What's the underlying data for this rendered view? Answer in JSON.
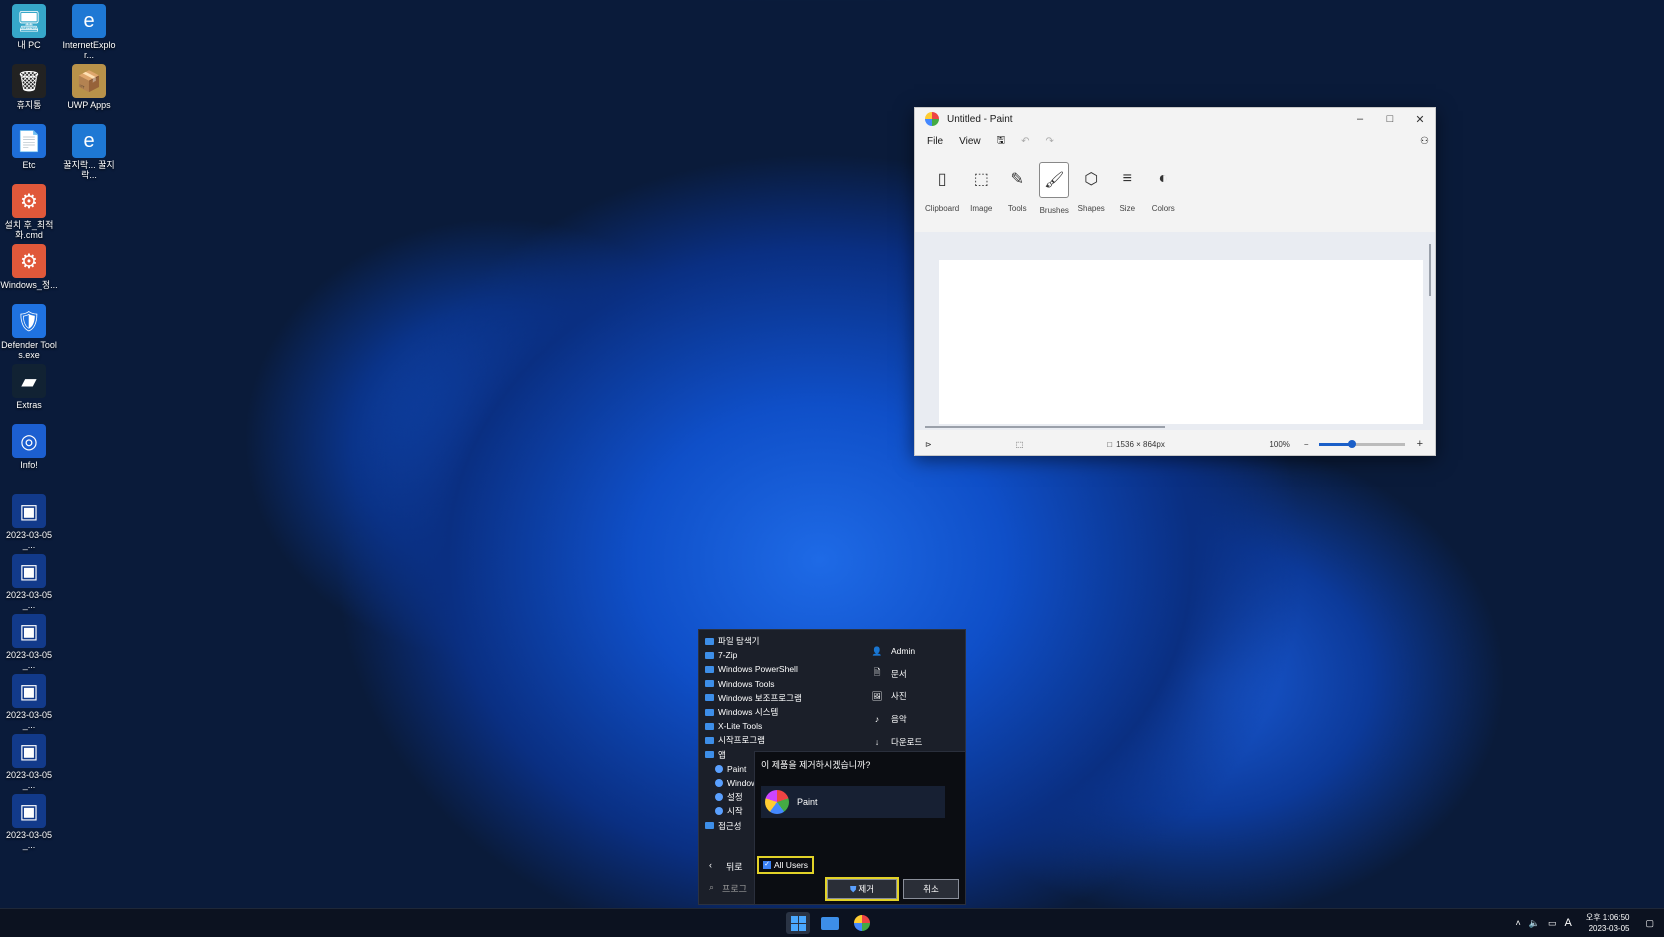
{
  "desktop": {
    "icons": [
      {
        "label": "내 PC",
        "glyph": "🖥"
      },
      {
        "label": "InternetExplor...",
        "glyph": "e"
      },
      {
        "label": "휴지통",
        "glyph": "🗑"
      },
      {
        "label": "UWP Apps",
        "glyph": "📦"
      },
      {
        "label": "Etc",
        "glyph": "📄"
      },
      {
        "label": "꿀지락... 꿀지락...",
        "glyph": "e"
      },
      {
        "label": "설치 후_최적화.cmd",
        "glyph": "⚙"
      },
      {
        "label": "Windows_정...",
        "glyph": "⚙"
      },
      {
        "label": "Defender Tools.exe",
        "glyph": "🛡"
      },
      {
        "label": "Extras",
        "glyph": "▰"
      },
      {
        "label": "Info!",
        "glyph": "◎"
      },
      {
        "label": "2023-03-05_...",
        "glyph": "▣"
      },
      {
        "label": "2023-03-05_...",
        "glyph": "▣"
      },
      {
        "label": "2023-03-05_...",
        "glyph": "▣"
      },
      {
        "label": "2023-03-05_...",
        "glyph": "▣"
      },
      {
        "label": "2023-03-05_...",
        "glyph": "▣"
      },
      {
        "label": "2023-03-05_...",
        "glyph": "▣"
      }
    ]
  },
  "paint": {
    "title": "Untitled - Paint",
    "menu": [
      "File",
      "View"
    ],
    "ribbon": [
      {
        "label": "Clipboard",
        "icon": "clipboard-icon",
        "glyph": "▯"
      },
      {
        "label": "Image",
        "icon": "select-icon",
        "glyph": "⬚"
      },
      {
        "label": "Tools",
        "icon": "tools-icon",
        "glyph": "✎"
      },
      {
        "label": "Brushes",
        "icon": "brush-icon",
        "glyph": "🖌"
      },
      {
        "label": "Shapes",
        "icon": "shapes-icon",
        "glyph": "⬡"
      },
      {
        "label": "Size",
        "icon": "size-icon",
        "glyph": "≡"
      },
      {
        "label": "Colors",
        "icon": "palette-icon",
        "glyph": "◐"
      }
    ],
    "status": {
      "dimensions": "1536 × 864px",
      "zoom": "100%"
    }
  },
  "start_menu": {
    "folders": [
      {
        "label": "파일 탐색기",
        "indent": false
      },
      {
        "label": "7-Zip",
        "indent": false
      },
      {
        "label": "Windows PowerShell",
        "indent": false
      },
      {
        "label": "Windows Tools",
        "indent": false
      },
      {
        "label": "Windows 보조프로그램",
        "indent": false
      },
      {
        "label": "Windows 시스템",
        "indent": false
      },
      {
        "label": "X-Lite Tools",
        "indent": false
      },
      {
        "label": "시작프로그램",
        "indent": false
      },
      {
        "label": "앱",
        "indent": false
      },
      {
        "label": "Paint",
        "indent": true
      },
      {
        "label": "Window",
        "indent": true
      },
      {
        "label": "설정",
        "indent": true
      },
      {
        "label": "시작",
        "indent": true
      },
      {
        "label": "접근성",
        "indent": false
      }
    ],
    "places": [
      {
        "label": "Admin",
        "icon": "user-icon",
        "glyph": "👤"
      },
      {
        "label": "문서",
        "icon": "document-icon",
        "glyph": "🗎"
      },
      {
        "label": "사진",
        "icon": "pictures-icon",
        "glyph": "🖼"
      },
      {
        "label": "음악",
        "icon": "music-icon",
        "glyph": "♪"
      },
      {
        "label": "다운로드",
        "icon": "download-icon",
        "glyph": "↓"
      }
    ],
    "back_label": "뒤로",
    "search_placeholder": "프로그"
  },
  "dialog": {
    "question": "이 제품을 제거하시겠습니까?",
    "app_name": "Paint",
    "checkbox_label": "All Users",
    "remove_label": "제거",
    "cancel_label": "취소"
  },
  "taskbar": {
    "time": "오후 1:06:50",
    "date": "2023-03-05",
    "ime": "A"
  }
}
